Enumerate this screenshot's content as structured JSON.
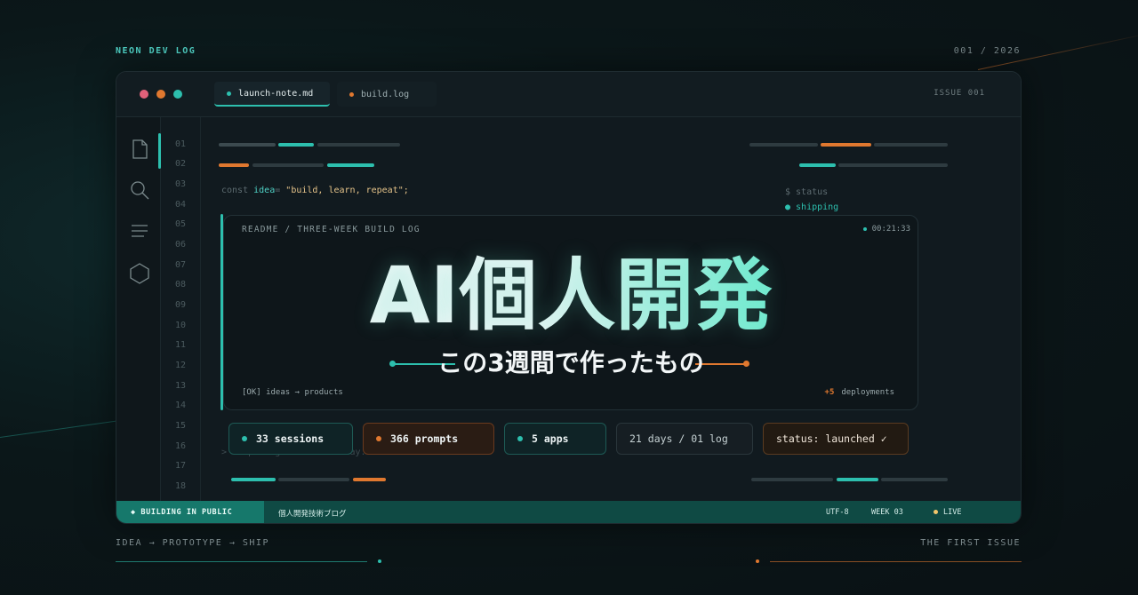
{
  "top": {
    "left_label": "NEON DEV LOG",
    "right_label": "001 / 2026"
  },
  "window": {
    "tabs": [
      {
        "label": "launch-note.md",
        "dot_color": "#2dbfae",
        "active": true
      },
      {
        "label": "build.log",
        "dot_color": "#e0782f",
        "active": false
      }
    ],
    "issue_label": "ISSUE 001"
  },
  "sidebar": {
    "icons": [
      "file-icon",
      "search-icon",
      "menu-icon",
      "hexagon-icon"
    ]
  },
  "gutter": {
    "line_numbers": [
      "01",
      "02",
      "03",
      "04",
      "05",
      "06",
      "07",
      "08",
      "09",
      "10",
      "11",
      "12",
      "13",
      "14",
      "15",
      "16",
      "17",
      "18"
    ]
  },
  "code": {
    "line3": {
      "keyword": "const",
      "name": "idea",
      "op": "=",
      "string": "\"build, learn, repeat\";"
    },
    "status_cmd": "$ status",
    "status_value": "● shipping",
    "line16_hidden": "> compiling the latest day..."
  },
  "panel": {
    "readme": "README / THREE-WEEK BUILD LOG",
    "timer": "00:21:33",
    "headline": "AI個人開発",
    "subtitle": "この3週間で作ったもの",
    "ok_line": "[OK] ideas → products",
    "deploy_count": "+5",
    "deploy_label": "deployments"
  },
  "chips": [
    {
      "label": "33 sessions",
      "dot": "#2dbfae"
    },
    {
      "label": "366 prompts",
      "dot": "#e0782f"
    },
    {
      "label": "5 apps",
      "dot": "#2dbfae"
    },
    {
      "label": "21 days / 01 log"
    },
    {
      "label": "status: launched ✓"
    }
  ],
  "statusbar": {
    "left": "◆ BUILDING IN PUBLIC",
    "title": "個人開発技術ブログ",
    "encoding": "UTF-8",
    "week": "WEEK 03",
    "live": "LIVE"
  },
  "bottom": {
    "left_label": "IDEA → PROTOTYPE → SHIP",
    "right_label": "THE FIRST ISSUE"
  },
  "colors": {
    "accent_teal": "#2dbfae",
    "accent_orange": "#e0782f",
    "background": "#0b1719"
  }
}
